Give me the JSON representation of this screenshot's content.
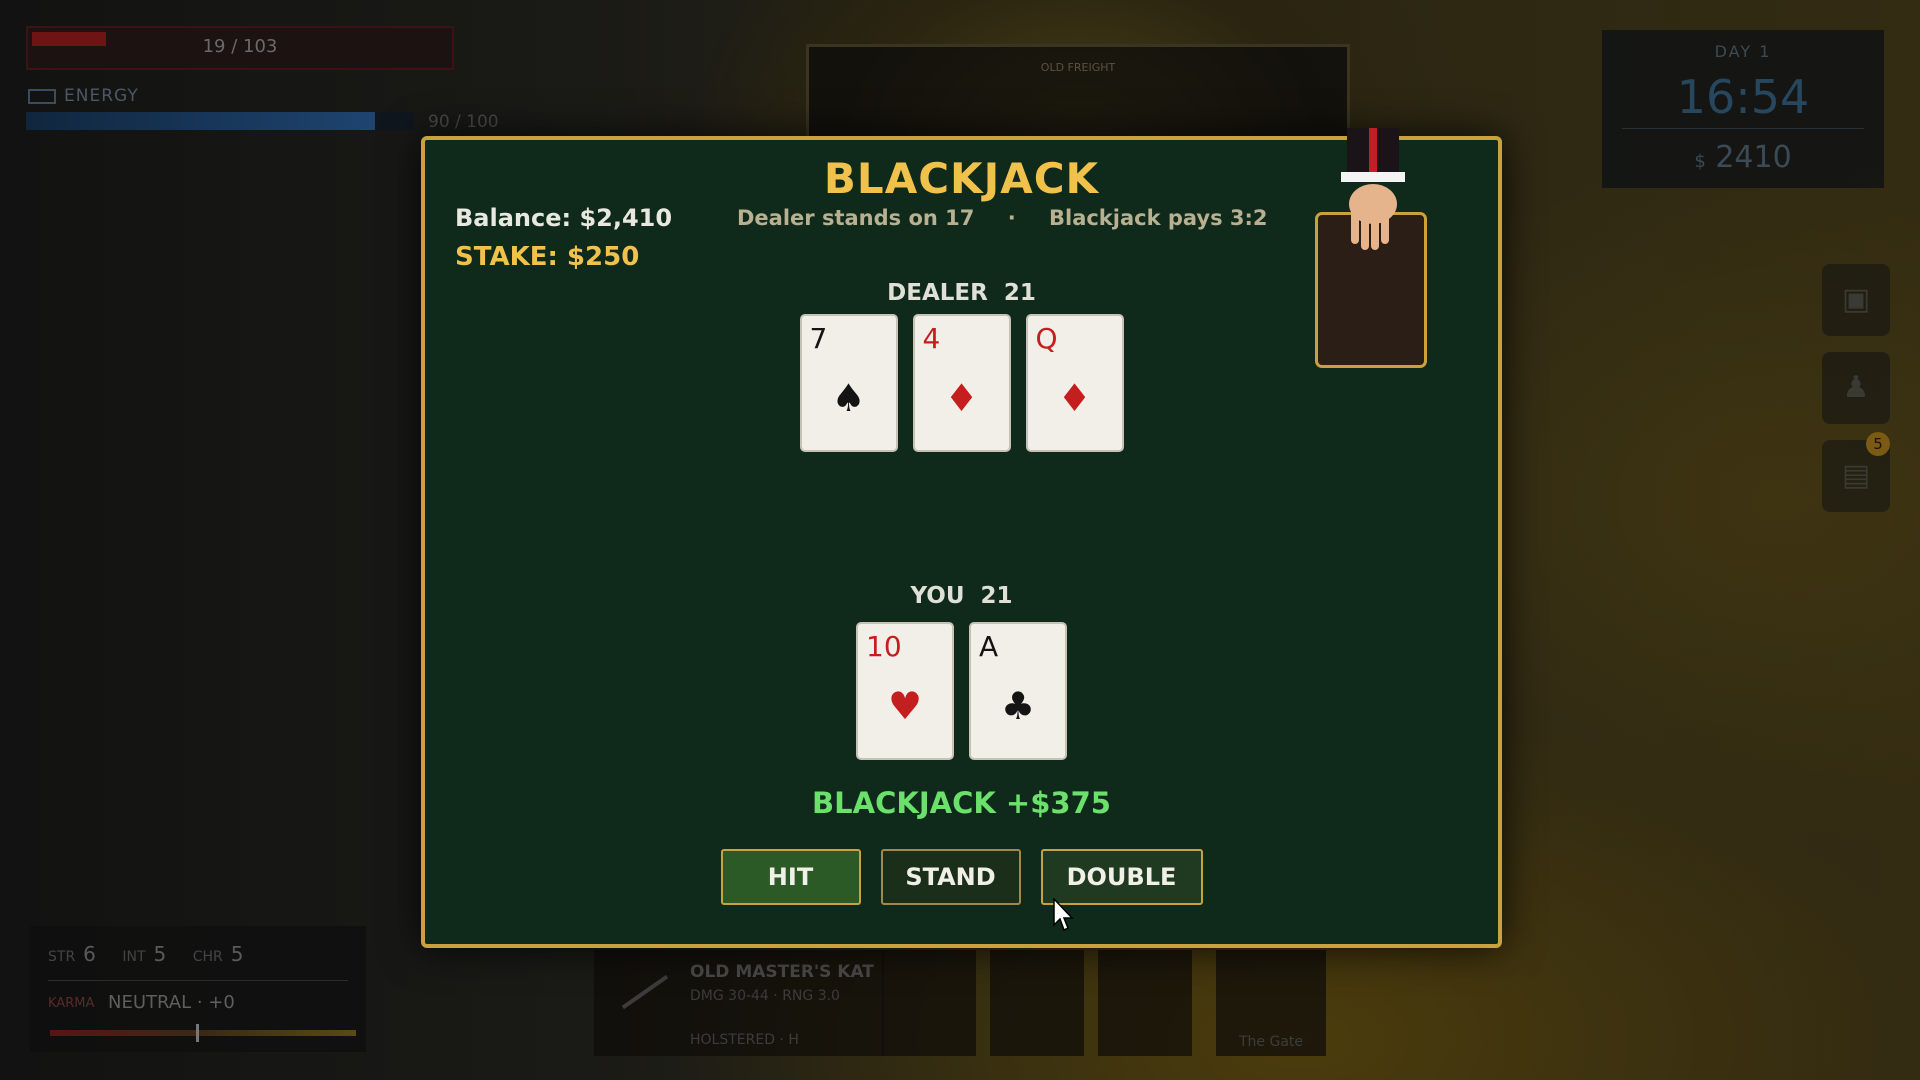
{
  "hud": {
    "health_text": "19 / 103",
    "health_fraction": 0.18,
    "energy_label": "ENERGY",
    "energy_text": "90 / 100",
    "energy_fraction": 0.9,
    "day": "DAY 1",
    "time": "16:54",
    "money": "2410",
    "money_symbol": "$",
    "side_badge": "5",
    "stats": {
      "str_label": "STR",
      "str": "6",
      "int_label": "INT",
      "int": "5",
      "chr_label": "CHR",
      "chr": "5"
    },
    "karma_label": "KARMA",
    "karma_status": "NEUTRAL · +0",
    "weapon_name": "OLD MASTER'S KAT",
    "weapon_stats": "DMG 30-44 · RNG 3.0",
    "weapon_state": "HOLSTERED · H",
    "gate_label": "The Gate",
    "board_title": "OLD FREIGHT"
  },
  "game": {
    "title": "BLACKJACK",
    "balance": "Balance:  $2,410",
    "stake": "STAKE:  $250",
    "rule_dealer": "Dealer stands on 17",
    "rule_separator": "·",
    "rule_payout": "Blackjack pays 3:2",
    "dealer_label": "DEALER",
    "dealer_value": "21",
    "player_label": "YOU",
    "player_value": "21",
    "dealer_cards": [
      {
        "rank": "7",
        "suit": "♠",
        "color": "black"
      },
      {
        "rank": "4",
        "suit": "♦",
        "color": "red"
      },
      {
        "rank": "Q",
        "suit": "♦",
        "color": "red"
      }
    ],
    "player_cards": [
      {
        "rank": "10",
        "suit": "♥",
        "color": "red"
      },
      {
        "rank": "A",
        "suit": "♣",
        "color": "black"
      }
    ],
    "result": "BLACKJACK +$375",
    "buttons": {
      "hit": "HIT",
      "stand": "STAND",
      "double": "DOUBLE"
    }
  },
  "colors": {
    "felt": "#0f2a1b",
    "gold": "#c9a23e",
    "title": "#f0c24c",
    "win": "#6be06b",
    "card_red": "#c41e1e"
  }
}
